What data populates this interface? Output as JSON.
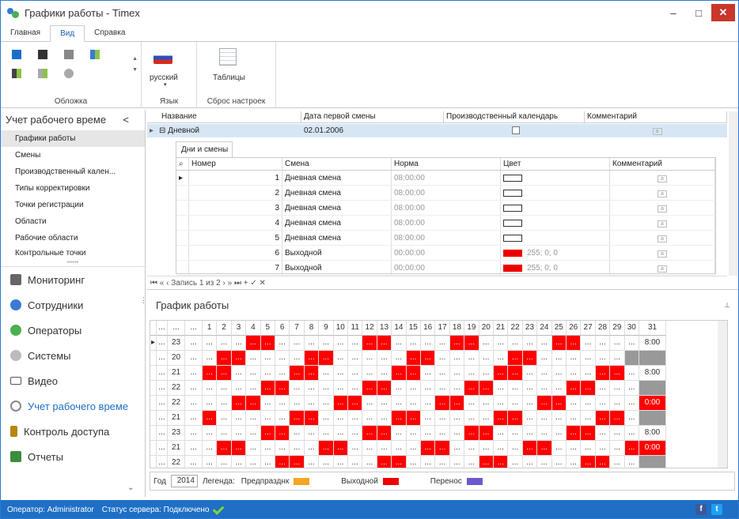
{
  "window": {
    "title": "Графики работы - Timex",
    "minimize": "–",
    "maximize": "□",
    "close": "✕"
  },
  "ribbon": {
    "tabs": [
      "Главная",
      "Вид",
      "Справка"
    ],
    "groups": {
      "skin": "Обложка",
      "language": "Язык",
      "reset": "Сброс настроек"
    },
    "language_value": "русский",
    "tables_button": "Таблицы"
  },
  "leftnav": {
    "section_title": "Учет рабочего време",
    "chevron": "<",
    "items": [
      "Графики работы",
      "Смены",
      "Производственный кален...",
      "Типы корректировки",
      "Точки регистрации",
      "Области",
      "Рабочие области",
      "Контрольные точки"
    ],
    "modules": [
      {
        "label": "Мониторинг",
        "icon": "monitoring-icon",
        "color": "#666"
      },
      {
        "label": "Сотрудники",
        "icon": "employees-icon",
        "color": "#3a7bd5"
      },
      {
        "label": "Операторы",
        "icon": "operators-icon",
        "color": "#4caf50"
      },
      {
        "label": "Системы",
        "icon": "systems-icon",
        "color": "#999"
      },
      {
        "label": "Видео",
        "icon": "video-icon",
        "color": "#555"
      },
      {
        "label": "Учет рабочего време",
        "icon": "clock-icon",
        "color": "#1b6fc9"
      },
      {
        "label": "Контроль доступа",
        "icon": "door-icon",
        "color": "#b8860b"
      },
      {
        "label": "Отчеты",
        "icon": "reports-icon",
        "color": "#3d8b3d"
      }
    ]
  },
  "schedules_grid": {
    "headers": [
      "Название",
      "Дата первой смены",
      "Производственный календарь",
      "Комментарий"
    ],
    "row": {
      "name": "Дневной",
      "expander": "⊟",
      "first_shift": "02.01.2006"
    }
  },
  "detail": {
    "tab": "Дни и смены",
    "headers": [
      "Номер",
      "Смена",
      "Норма",
      "Цвет",
      "Комментарий"
    ],
    "rows": [
      {
        "num": "1",
        "shift": "Дневная смена",
        "norm": "08:00:00",
        "color": ""
      },
      {
        "num": "2",
        "shift": "Дневная смена",
        "norm": "08:00:00",
        "color": ""
      },
      {
        "num": "3",
        "shift": "Дневная смена",
        "norm": "08:00:00",
        "color": ""
      },
      {
        "num": "4",
        "shift": "Дневная смена",
        "norm": "08:00:00",
        "color": ""
      },
      {
        "num": "5",
        "shift": "Дневная смена",
        "norm": "08:00:00",
        "color": ""
      },
      {
        "num": "6",
        "shift": "Выходной",
        "norm": "00:00:00",
        "color": "255; 0; 0"
      },
      {
        "num": "7",
        "shift": "Выходной",
        "norm": "00:00:00",
        "color": "255; 0; 0"
      }
    ],
    "navigator": "Запись 1 из 2",
    "comment_icon": "a"
  },
  "schedule": {
    "title": "График работы",
    "days_header": [
      "1",
      "2",
      "3",
      "4",
      "5",
      "6",
      "7",
      "8",
      "9",
      "10",
      "11",
      "12",
      "13",
      "14",
      "15",
      "16",
      "17",
      "18",
      "19",
      "20",
      "21",
      "22",
      "23",
      "24",
      "25",
      "26",
      "27",
      "28",
      "29",
      "30",
      "31"
    ],
    "ellipsis": "...",
    "rows": [
      {
        "count": "23",
        "last": "8:00",
        "red": [
          4,
          5,
          12,
          13,
          18,
          19,
          25,
          26
        ],
        "gray": []
      },
      {
        "count": "20",
        "last": "",
        "red": [
          2,
          3,
          8,
          9,
          15,
          16,
          22,
          23
        ],
        "gray": [
          30,
          31
        ]
      },
      {
        "count": "21",
        "last": "8:00",
        "red": [
          1,
          2,
          7,
          8,
          14,
          15,
          21,
          22,
          28,
          29
        ],
        "gray": []
      },
      {
        "count": "22",
        "last": "",
        "red": [
          5,
          6,
          12,
          13,
          19,
          20,
          26,
          27
        ],
        "gray": [
          31
        ]
      },
      {
        "count": "22",
        "last": "0:00",
        "red": [
          3,
          4,
          10,
          11,
          17,
          18,
          24,
          25,
          31
        ],
        "gray": []
      },
      {
        "count": "21",
        "last": "",
        "red": [
          1,
          7,
          8,
          14,
          15,
          21,
          22,
          28,
          29
        ],
        "gray": [
          31
        ]
      },
      {
        "count": "23",
        "last": "8:00",
        "red": [
          5,
          6,
          12,
          13,
          19,
          20,
          26,
          27
        ],
        "gray": []
      },
      {
        "count": "21",
        "last": "0:00",
        "red": [
          2,
          3,
          9,
          10,
          16,
          17,
          23,
          24,
          30,
          31
        ],
        "gray": []
      },
      {
        "count": "22",
        "last": "",
        "red": [
          6,
          7,
          13,
          14,
          20,
          21,
          27,
          28
        ],
        "gray": [
          31
        ]
      }
    ]
  },
  "footer": {
    "year_label": "Год",
    "year": "2014",
    "legend_label": "Легенда:",
    "legend": [
      {
        "label": "Предпразднк",
        "color": "#f5a623"
      },
      {
        "label": "Выходной",
        "color": "#ee0000"
      },
      {
        "label": "Перенос",
        "color": "#6a5acd"
      }
    ]
  },
  "status": {
    "operator": "Оператор: Administrator",
    "server": "Статус сервера: Подключено"
  },
  "colors": {
    "accent": "#1f6fc5",
    "selection": "#d7e6f5"
  }
}
